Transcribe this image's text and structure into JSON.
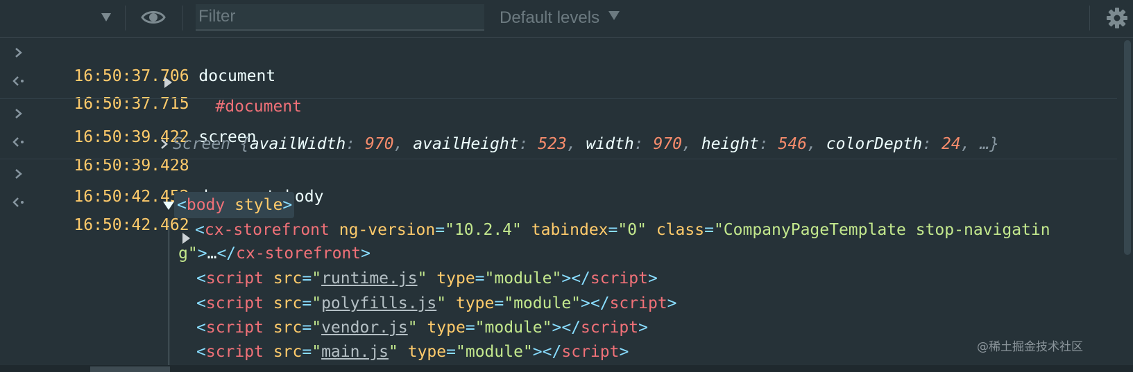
{
  "toolbar": {
    "filter_placeholder": "Filter",
    "levels_label": "Default levels"
  },
  "console": {
    "entries": [
      {
        "direction": "input",
        "time": "16:50:37.706",
        "text": "document"
      },
      {
        "direction": "output",
        "time": "16:50:37.715",
        "text": "#document"
      },
      {
        "direction": "input",
        "time": "16:50:39.422",
        "text": "screen"
      },
      {
        "direction": "output",
        "time": "16:50:39.428",
        "object_name": "Screen",
        "open": "{",
        "props": [
          {
            "key": "availWidth",
            "value": "970"
          },
          {
            "key": "availHeight",
            "value": "523"
          },
          {
            "key": "width",
            "value": "970"
          },
          {
            "key": "height",
            "value": "546"
          },
          {
            "key": "colorDepth",
            "value": "24"
          }
        ],
        "ellipsis": "…}"
      },
      {
        "direction": "input",
        "time": "16:50:42.452",
        "text": "document.body"
      },
      {
        "direction": "output",
        "time": "16:50:42.462",
        "body_tag": "body",
        "body_attr": "style"
      }
    ],
    "body_children": {
      "storefront": {
        "tag": "cx-storefront",
        "attrs": [
          {
            "name": "ng-version",
            "value": "10.2.4"
          },
          {
            "name": "tabindex",
            "value": "0"
          },
          {
            "name": "class",
            "value": "CompanyPageTemplate stop-navigatin"
          }
        ],
        "wrap": "g",
        "collapsed": "…",
        "close": "cx-storefront"
      },
      "scripts": [
        {
          "src": "runtime.js",
          "type": "module"
        },
        {
          "src": "polyfills.js",
          "type": "module"
        },
        {
          "src": "vendor.js",
          "type": "module"
        },
        {
          "src": "main.js",
          "type": "module"
        }
      ],
      "script_tag": "script",
      "src_attr": "src",
      "type_attr": "type"
    }
  },
  "watermark": "@稀土掘金技术社区",
  "colors": {
    "background": "#263238",
    "timestamp": "#ffcb6b",
    "tag": "#f07178",
    "attribute_value": "#c3e88d",
    "number": "#f78c6c"
  }
}
